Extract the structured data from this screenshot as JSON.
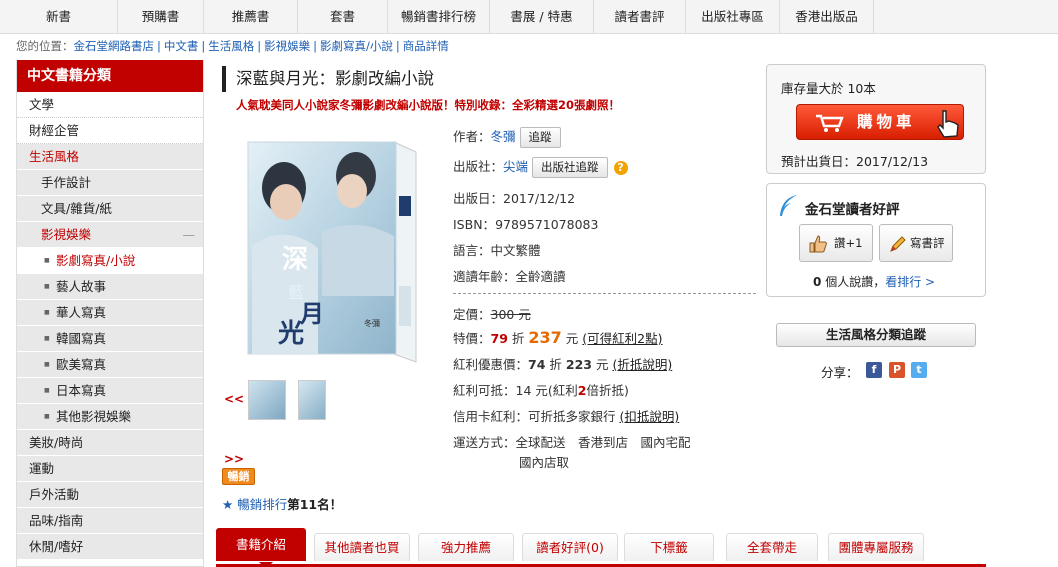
{
  "topnav": [
    {
      "label": "新書"
    },
    {
      "label": "預購書"
    },
    {
      "label": "推薦書"
    },
    {
      "label": "套書"
    },
    {
      "label": "暢銷書排行榜"
    },
    {
      "label": "書展 / 特惠"
    },
    {
      "label": "讀者書評"
    },
    {
      "label": "出版社專區"
    },
    {
      "label": "香港出版品"
    }
  ],
  "breadcrumb": {
    "prefix": "您的位置：",
    "items": [
      "金石堂網路書店",
      "中文書",
      "生活風格",
      "影視娛樂",
      "影劇寫真/小說",
      "商品詳情"
    ]
  },
  "sidebar": {
    "title": "中文書籍分類",
    "top_items": [
      "文學",
      "財經企管"
    ],
    "active_category": "生活風格",
    "sub_items": [
      "手作設計",
      "文具/雜貨/紙"
    ],
    "expanded_item": "影視娛樂",
    "collapse_symbol": "—",
    "subsub_items": [
      "影劇寫真/小說",
      "藝人故事",
      "華人寫真",
      "韓國寫真",
      "歐美寫真",
      "日本寫真",
      "其他影視娛樂"
    ],
    "bottom_items": [
      "美妝/時尚",
      "運動",
      "戶外活動",
      "品味/指南",
      "休閒/嗜好"
    ]
  },
  "product": {
    "title": "深藍與月光：影劇改編小說",
    "subtitle": "人氣耽美同人小說家冬彌影劇改編小說版！特別收錄：全彩精選20張劇照！",
    "author_label": "作者：",
    "author": "冬彌",
    "follow_label": "追蹤",
    "publisher_label": "出版社：",
    "publisher": "尖端",
    "publisher_follow_label": "出版社追蹤",
    "help_symbol": "?",
    "pubdate_label": "出版日：",
    "pubdate": "2017/12/12",
    "isbn_label": "ISBN：",
    "isbn": "9789571078083",
    "lang_label": "語言：",
    "lang": "中文繁體",
    "age_label": "適讀年齡：",
    "age": "全齡適讀",
    "list_price_label": "定價：",
    "list_price": "300 元",
    "special_label": "特價：",
    "special_discount": "79",
    "zhe": "折",
    "special_price": "237",
    "special_unit": "元",
    "special_note": "(可得紅利2點)",
    "bonus_label": "紅利優惠價：",
    "bonus_discount": "74",
    "bonus_zhe": "折",
    "bonus_price": "223",
    "bonus_unit": "元",
    "bonus_note": "(折抵說明)",
    "redeem_label": "紅利可抵：",
    "redeem_pre": "14 元(紅利",
    "redeem_mult": "2",
    "redeem_post": "倍折抵)",
    "card_label": "信用卡紅利：",
    "card_text": "可折抵多家銀行",
    "card_note": "(扣抵說明)",
    "ship_label": "運送方式：",
    "ship_line1": "全球配送　香港到店　國內宅配",
    "ship_line2": "國內店取",
    "cover_text": "深藍與月光",
    "cover_author": "冬彌",
    "thumb_prev": "<<",
    "thumb_next": ">>",
    "hot_badge": "暢銷",
    "rank_link": "暢銷排行",
    "rank_text": "第11名！",
    "star": "★"
  },
  "buybox": {
    "stock": "庫存量大於 10本",
    "cart_label": "購物車",
    "ship_date": "預計出貨日：2017/12/13"
  },
  "reviews": {
    "title": "金石堂讀者好評",
    "like_label": "讚+1",
    "write_label": "寫書評",
    "count": "0",
    "count_text": "個人說讚，",
    "rank_link": "看排行 >"
  },
  "track_label": "生活風格分類追蹤",
  "share_label": "分享：",
  "social": [
    {
      "name": "facebook",
      "glyph": "f",
      "color": "#3b5998"
    },
    {
      "name": "plurk",
      "glyph": "P",
      "color": "#d9542b"
    },
    {
      "name": "twitter",
      "glyph": "t",
      "color": "#55acee"
    }
  ],
  "tabs": [
    "書籍介紹",
    "其他讀者也買",
    "強力推薦",
    "讀者好評(0)",
    "下標籤",
    "全套帶走",
    "團體專屬服務"
  ],
  "colors": {
    "brand_red": "#c10000",
    "link_blue": "#1f5fb3",
    "price_orange": "#e46a00"
  }
}
